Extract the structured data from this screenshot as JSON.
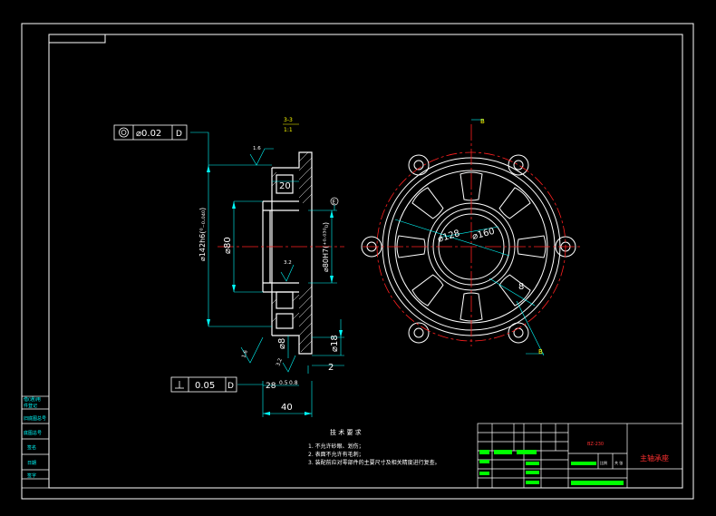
{
  "colors": {
    "background": "#000000",
    "outline": "#ffffff",
    "dimension": "#00ffff",
    "centerline": "#ff2020",
    "annotation": "#ffff00",
    "highlight": "#00ff00",
    "title_red": "#ff3030"
  },
  "section": {
    "label_top": "3-3",
    "label_bottom": "1:1"
  },
  "tolerance": {
    "concentricity_value": "0.02",
    "concentricity_datum": "D",
    "perpendicularity_value": "0.05",
    "perpendicularity_datum": "D"
  },
  "roughness": {
    "top": "1.6",
    "inner": "3.2",
    "lower_left": "1.6",
    "lower_mid": "3.2"
  },
  "dimensions": {
    "d20": "20",
    "d142": "⌀142h6(⁰₋₀.₀₄₀)",
    "d80": "⌀80",
    "d80h7": "⌀80H7(⁺⁰·⁰³⁰₀)",
    "d8": "⌀8",
    "d18": "⌀18",
    "d2": "2",
    "d28": "28",
    "d05": "0.5",
    "d08": "0.8",
    "d40": "40",
    "d128": "⌀128",
    "d160": "⌀160",
    "r8": "8",
    "mark_e": "E",
    "mark_b": "B"
  },
  "tech": {
    "title": "技 术 要 求",
    "items": [
      "1. 不允许砂眼、划伤；",
      "2. 表面不允许有毛刺；",
      "3. 装配前应对零部件的主要尺寸及相关精度进行复查。"
    ]
  },
  "leftstrip": {
    "labels": [
      "借(通)用",
      "件登记",
      "旧底图总号",
      "底图总号",
      "签名",
      "日期",
      "签字"
    ]
  },
  "titleblock": {
    "code": "BZ-230",
    "name": "主轴承座",
    "scale_label": "比例",
    "sheet_label": "共 张"
  }
}
